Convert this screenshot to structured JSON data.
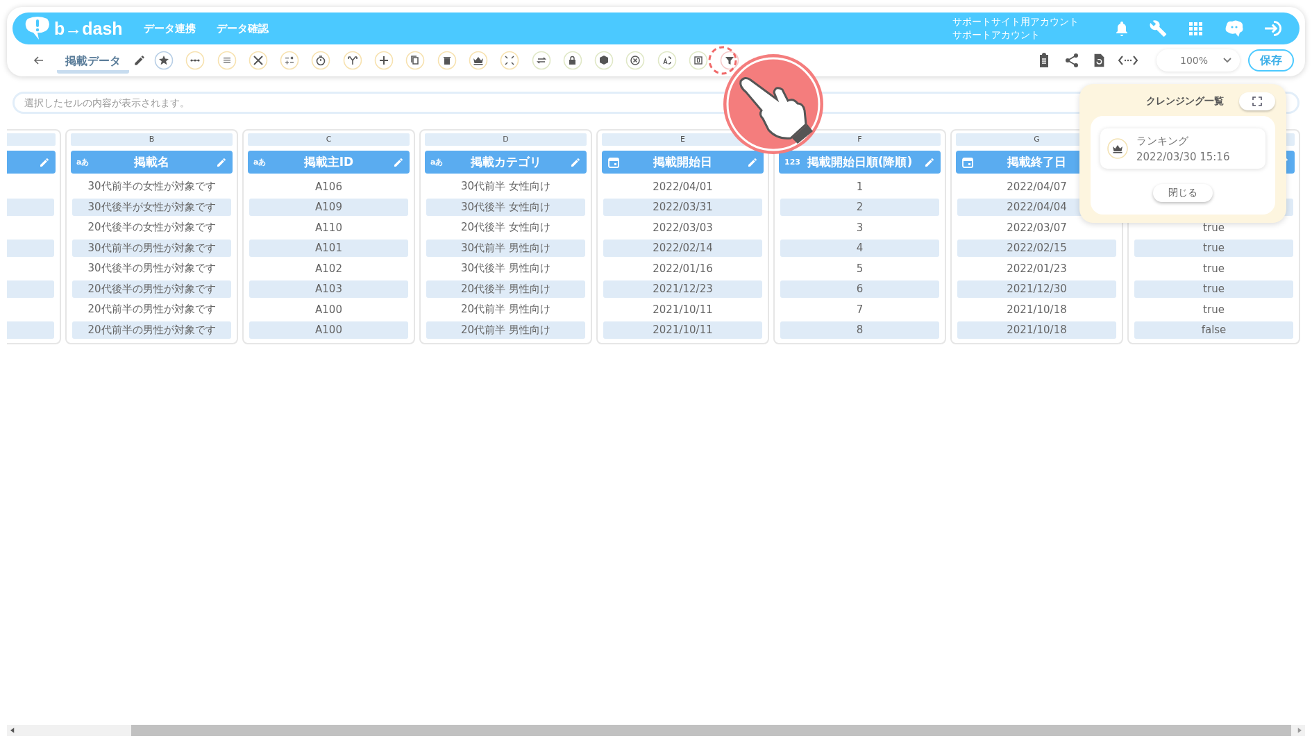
{
  "header": {
    "logo": "b→dash",
    "nav": [
      {
        "label": "データ連携"
      },
      {
        "label": "データ確認"
      }
    ],
    "account": [
      "サポートサイト用アカウント",
      "サポートアカウント"
    ]
  },
  "toolbar": {
    "sheet_name": "掲載データ",
    "zoom": "100%",
    "save": "保存"
  },
  "cell_bar": {
    "placeholder": "選択したセルの内容が表示されます。"
  },
  "columns": [
    {
      "kind": "partial",
      "cells": [
        null,
        null,
        null,
        null,
        null,
        null,
        null,
        null
      ]
    },
    {
      "letter": "B",
      "kind": "text",
      "type_label": "aあ",
      "title": "掲載名",
      "cells": [
        "30代前半の女性が対象です",
        "30代後半が女性が対象です",
        "20代後半の女性が対象です",
        "30代前半の男性が対象です",
        "30代後半の男性が対象です",
        "20代後半の男性が対象です",
        "20代前半の男性が対象です",
        "20代前半の男性が対象です"
      ]
    },
    {
      "letter": "C",
      "kind": "text",
      "type_label": "aあ",
      "title": "掲載主ID",
      "cells": [
        "A106",
        "A109",
        "A110",
        "A101",
        "A102",
        "A103",
        "A100",
        "A100"
      ]
    },
    {
      "letter": "D",
      "kind": "text",
      "type_label": "aあ",
      "title": "掲載カテゴリ",
      "cells": [
        "30代前半 女性向け",
        "30代後半 女性向け",
        "20代後半 女性向け",
        "30代前半 男性向け",
        "30代後半 男性向け",
        "20代後半 男性向け",
        "20代前半 男性向け",
        "20代前半 男性向け"
      ]
    },
    {
      "letter": "E",
      "kind": "date",
      "title": "掲載開始日",
      "cells": [
        "2022/04/01",
        "2022/03/31",
        "2022/03/03",
        "2022/02/14",
        "2022/01/16",
        "2021/12/23",
        "2021/10/11",
        "2021/10/11"
      ]
    },
    {
      "letter": "F",
      "kind": "number",
      "type_label": "123",
      "title": "掲載開始日順(降順)",
      "cells": [
        "1",
        "2",
        "3",
        "4",
        "5",
        "6",
        "7",
        "8"
      ]
    },
    {
      "letter": "G",
      "kind": "date",
      "title": "掲載終了日",
      "cells": [
        "2022/04/07",
        "2022/04/04",
        "2022/03/07",
        "2022/02/15",
        "2022/01/23",
        "2021/12/30",
        "2021/10/18",
        "2021/10/18"
      ]
    },
    {
      "kind": "covered",
      "cells": [
        null,
        null,
        "true",
        "true",
        "true",
        "true",
        "true",
        "false"
      ]
    }
  ],
  "popup": {
    "title": "クレンジング一覧",
    "items": [
      {
        "name": "ランキング",
        "time": "2022/03/30 15:16"
      }
    ],
    "close": "閉じる"
  }
}
